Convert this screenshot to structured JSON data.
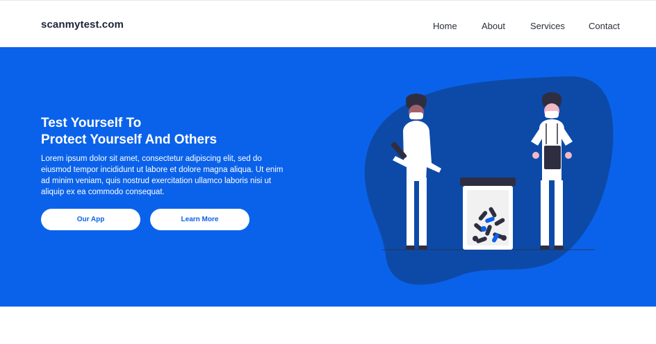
{
  "header": {
    "brand": "scanmytest.com",
    "nav": [
      {
        "label": "Home"
      },
      {
        "label": "About"
      },
      {
        "label": "Services"
      },
      {
        "label": "Contact"
      }
    ]
  },
  "hero": {
    "title_line1": "Test Yourself To",
    "title_line2": "Protect Yourself And Others",
    "body": "Lorem ipsum dolor sit amet, consectetur adipiscing elit, sed do eiusmod tempor incididunt ut labore et dolore magna aliqua. Ut enim ad minim veniam, quis nostrud exercitation ullamco laboris nisi ut aliquip ex ea commodo consequat.",
    "primary_button": "Our App",
    "secondary_button": "Learn More"
  },
  "colors": {
    "hero_background": "#0b62ea",
    "blob": "#0d4aa8",
    "figure_dark": "#2f2e41",
    "accent_pink": "#f2b8c6"
  },
  "icons": [
    "doctor-with-clipboard-illustration",
    "nurse-with-stethoscope-illustration",
    "pill-jar-illustration"
  ]
}
